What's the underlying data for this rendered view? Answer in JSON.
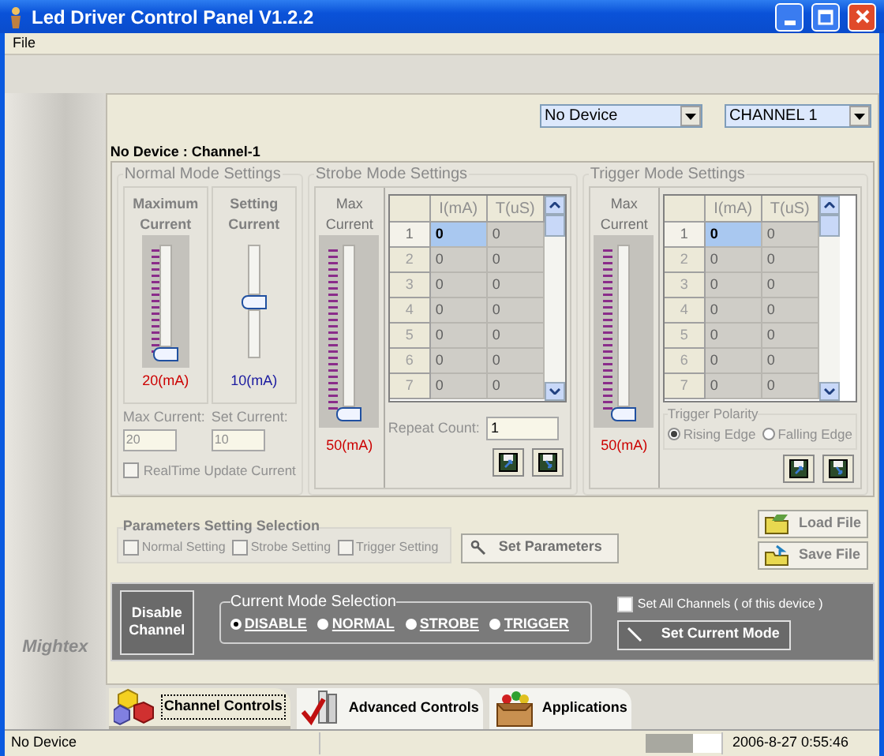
{
  "window": {
    "title": "Led Driver Control Panel V1.2.2"
  },
  "menu": [
    "File"
  ],
  "sidebar": {
    "brand": "Mightex"
  },
  "device_select": {
    "value": "No Device"
  },
  "channel_select": {
    "value": "CHANNEL 1"
  },
  "heading": "No Device : Channel-1",
  "normal_mode": {
    "title": "Normal Mode Settings",
    "sliders": [
      {
        "label": "Maximum Current",
        "level": 0,
        "reading": "20(mA)",
        "color": "#cc0000",
        "kind": "dense"
      },
      {
        "label": "Setting Current",
        "level": 0.5,
        "reading": "10(mA)",
        "color": "#1a1aa0",
        "kind": "sparse"
      }
    ],
    "fields": [
      {
        "label": "Max Current:",
        "value": "20"
      },
      {
        "label": "Set Current:",
        "value": "10"
      }
    ],
    "realtime": {
      "label": "RealTime Update Current",
      "checked": false
    }
  },
  "strobe_mode": {
    "title": "Strobe Mode Settings",
    "slider": {
      "label": "Max Current",
      "level": 0,
      "reading": "50(mA)"
    },
    "table": {
      "columns": [
        "I(mA)",
        "T(uS)"
      ],
      "rows": [
        {
          "index": "1",
          "cells": [
            "0",
            "0"
          ],
          "selected": true
        },
        {
          "index": "2",
          "cells": [
            "0",
            "0"
          ],
          "selected": false
        },
        {
          "index": "3",
          "cells": [
            "0",
            "0"
          ],
          "selected": false
        },
        {
          "index": "4",
          "cells": [
            "0",
            "0"
          ],
          "selected": false
        },
        {
          "index": "5",
          "cells": [
            "0",
            "0"
          ],
          "selected": false
        },
        {
          "index": "6",
          "cells": [
            "0",
            "0"
          ],
          "selected": false
        },
        {
          "index": "7",
          "cells": [
            "0",
            "0"
          ],
          "selected": false
        }
      ]
    },
    "repeat_count": {
      "label": "Repeat Count:",
      "value": "1"
    }
  },
  "trigger_mode": {
    "title": "Trigger Mode Settings",
    "slider": {
      "label": "Max Current",
      "level": 0,
      "reading": "50(mA)"
    },
    "table": {
      "columns": [
        "I(mA)",
        "T(uS)"
      ],
      "rows": [
        {
          "index": "1",
          "cells": [
            "0",
            "0"
          ],
          "selected": true
        },
        {
          "index": "2",
          "cells": [
            "0",
            "0"
          ],
          "selected": false
        },
        {
          "index": "3",
          "cells": [
            "0",
            "0"
          ],
          "selected": false
        },
        {
          "index": "4",
          "cells": [
            "0",
            "0"
          ],
          "selected": false
        },
        {
          "index": "5",
          "cells": [
            "0",
            "0"
          ],
          "selected": false
        },
        {
          "index": "6",
          "cells": [
            "0",
            "0"
          ],
          "selected": false
        },
        {
          "index": "7",
          "cells": [
            "0",
            "0"
          ],
          "selected": false
        }
      ]
    },
    "polarity": {
      "title": "Trigger Polarity",
      "options": [
        {
          "label": "Rising Edge",
          "selected": true
        },
        {
          "label": "Falling Edge",
          "selected": false
        }
      ]
    }
  },
  "parameters": {
    "title": "Parameters Setting Selection",
    "options": [
      {
        "label": "Normal Setting",
        "checked": false
      },
      {
        "label": "Strobe Setting",
        "checked": false
      },
      {
        "label": "Trigger Setting",
        "checked": false
      }
    ],
    "button": "Set Parameters"
  },
  "file_buttons": [
    {
      "label": "Load File",
      "kind": "load"
    },
    {
      "label": "Save File",
      "kind": "save"
    }
  ],
  "mode": {
    "disable_button": "Disable Channel",
    "title": "Current Mode Selection",
    "options": [
      {
        "label": "DISABLE",
        "selected": true
      },
      {
        "label": "NORMAL",
        "selected": false
      },
      {
        "label": "STROBE",
        "selected": false
      },
      {
        "label": "TRIGGER",
        "selected": false
      }
    ],
    "set_all": {
      "label": "Set All Channels ( of this device )",
      "checked": false
    },
    "button": "Set Current Mode"
  },
  "tabs": [
    {
      "label": "Channel Controls",
      "kind": "cubes",
      "selected": true
    },
    {
      "label": "Advanced Controls",
      "kind": "check",
      "selected": false
    },
    {
      "label": "Applications",
      "kind": "box",
      "selected": false
    }
  ],
  "status_bar": {
    "text": "No Device",
    "time": "2006-8-27 0:55:46"
  }
}
